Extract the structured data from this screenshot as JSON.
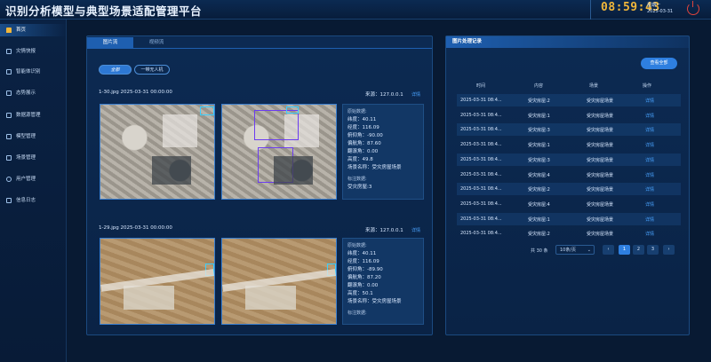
{
  "header": {
    "title": "识别分析模型与典型场景适配管理平台",
    "clock": "08:59:43",
    "weekday": "星期一",
    "date": "2025-03-31",
    "power_icon": "power-icon"
  },
  "sidebar": {
    "items": [
      {
        "label": "首页",
        "icon": "home-icon"
      },
      {
        "label": "灾情快报",
        "icon": "document-icon"
      },
      {
        "label": "智能体识别",
        "icon": "document-icon"
      },
      {
        "label": "态势展示",
        "icon": "document-icon"
      },
      {
        "label": "数据源管理",
        "icon": "document-icon"
      },
      {
        "label": "模型管理",
        "icon": "document-icon"
      },
      {
        "label": "场景管理",
        "icon": "document-icon"
      },
      {
        "label": "用户管理",
        "icon": "user-icon"
      },
      {
        "label": "信息日志",
        "icon": "document-icon"
      }
    ]
  },
  "main": {
    "tabs": [
      "图片流",
      "视频流"
    ],
    "filters": [
      "全部",
      "一带无人机"
    ],
    "records": [
      {
        "title": "1-30.jpg 2025-03-31 00:00:00",
        "source": "来源：127.0.0.1",
        "detail": "详情",
        "meta_heading": "原始数据:",
        "meta": [
          "纬度：40.11",
          "经度：116.09",
          "俯仰角：-90.00",
          "偏航角：87.60",
          "翻滚角：0.00",
          "高度：49.8",
          "场景名称：受灾房屋场景"
        ],
        "label_heading": "标注数据:",
        "label_value": "受灾房屋:3"
      },
      {
        "title": "1-29.jpg 2025-03-31 00:00:00",
        "source": "来源：127.0.0.1",
        "detail": "详情",
        "meta_heading": "原始数据:",
        "meta": [
          "纬度：40.11",
          "经度：116.09",
          "俯仰角：-89.90",
          "偏航角：87.20",
          "翻滚角：0.00",
          "高度：50.1",
          "场景名称：受灾房屋场景"
        ],
        "label_heading": "标注数据:"
      }
    ]
  },
  "right_panel": {
    "title": "图片处理记录",
    "view_all": "查看全部",
    "columns": [
      "时间",
      "内容",
      "场景",
      "操作"
    ],
    "rows": [
      [
        "2025-03-31 08:4...",
        "受灾房屋:2",
        "受灾房屋场景",
        "详情"
      ],
      [
        "2025-03-31 08:4...",
        "受灾房屋:1",
        "受灾房屋场景",
        "详情"
      ],
      [
        "2025-03-31 08:4...",
        "受灾房屋:3",
        "受灾房屋场景",
        "详情"
      ],
      [
        "2025-03-31 08:4...",
        "受灾房屋:1",
        "受灾房屋场景",
        "详情"
      ],
      [
        "2025-03-31 08:4...",
        "受灾房屋:3",
        "受灾房屋场景",
        "详情"
      ],
      [
        "2025-03-31 08:4...",
        "受灾房屋:4",
        "受灾房屋场景",
        "详情"
      ],
      [
        "2025-03-31 08:4...",
        "受灾房屋:2",
        "受灾房屋场景",
        "详情"
      ],
      [
        "2025-03-31 08:4...",
        "受灾房屋:4",
        "受灾房屋场景",
        "详情"
      ],
      [
        "2025-03-31 08:4...",
        "受灾房屋:1",
        "受灾房屋场景",
        "详情"
      ],
      [
        "2025-03-31 08:4...",
        "受灾房屋:2",
        "受灾房屋场景",
        "详情"
      ]
    ],
    "pagination": {
      "total": "共 30 条",
      "page_size": "10条/页",
      "pages": [
        "1",
        "2",
        "3"
      ],
      "prev": "‹",
      "next": "›"
    }
  },
  "colors": {
    "background": "#081a33",
    "accent": "#2e7fe0",
    "clock": "#f0b63a",
    "power": "#e0443c",
    "link": "#4aa3ff"
  }
}
